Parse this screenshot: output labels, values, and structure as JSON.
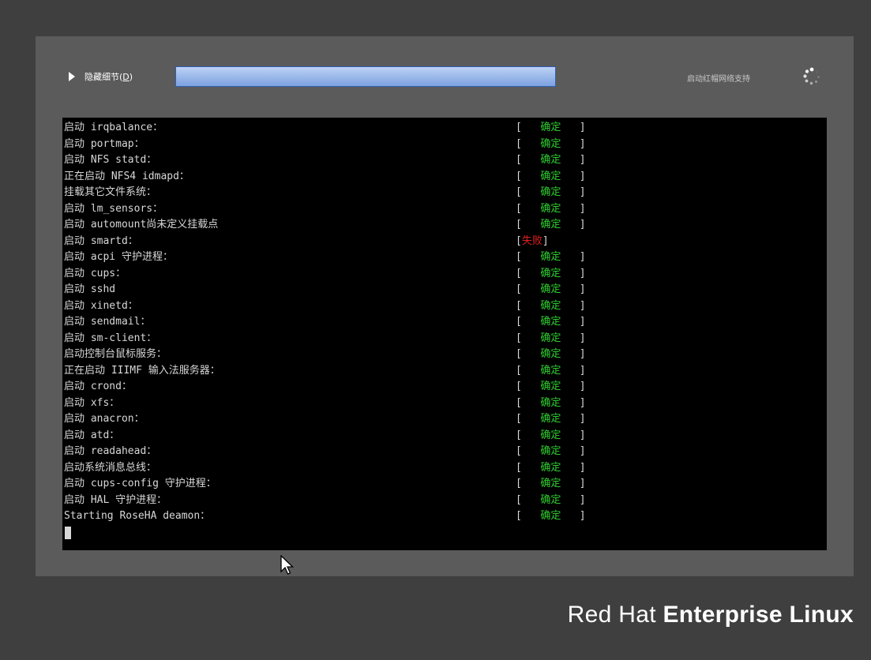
{
  "header": {
    "toggle_label_prefix": "隐藏细节(",
    "toggle_label_key": "D",
    "toggle_label_suffix": ")",
    "status_text": "启动红帽网络支持"
  },
  "console": {
    "lines": [
      {
        "msg": "启动 irqbalance：",
        "status": "确定"
      },
      {
        "msg": "启动 portmap：",
        "status": "确定"
      },
      {
        "msg": "启动 NFS statd：",
        "status": "确定"
      },
      {
        "msg": "正在启动 NFS4 idmapd：",
        "status": "确定"
      },
      {
        "msg": "挂载其它文件系统：",
        "status": "确定"
      },
      {
        "msg": "启动 lm_sensors：",
        "status": "确定"
      },
      {
        "msg": "启动 automount尚未定义挂载点",
        "status": "确定"
      },
      {
        "msg": "启动 smartd：",
        "status": "失败"
      },
      {
        "msg": "启动 acpi 守护进程：",
        "status": "确定"
      },
      {
        "msg": "启动 cups：",
        "status": "确定"
      },
      {
        "msg": "启动 sshd",
        "status": "确定"
      },
      {
        "msg": "启动 xinetd：",
        "status": "确定"
      },
      {
        "msg": "启动 sendmail：",
        "status": "确定"
      },
      {
        "msg": "启动 sm-client：",
        "status": "确定"
      },
      {
        "msg": "启动控制台鼠标服务：",
        "status": "确定"
      },
      {
        "msg": "正在启动 IIIMF 输入法服务器：",
        "status": "确定"
      },
      {
        "msg": "启动 crond：",
        "status": "确定"
      },
      {
        "msg": "启动 xfs：",
        "status": "确定"
      },
      {
        "msg": "启动 anacron：",
        "status": "确定"
      },
      {
        "msg": "启动 atd：",
        "status": "确定"
      },
      {
        "msg": "启动 readahead：",
        "status": "确定"
      },
      {
        "msg": "启动系统消息总线：",
        "status": "确定"
      },
      {
        "msg": "启动 cups-config 守护进程：",
        "status": "确定"
      },
      {
        "msg": "启动 HAL 守护进程：",
        "status": "确定"
      },
      {
        "msg": "Starting RoseHA deamon：",
        "status": "确定"
      }
    ],
    "ok_color": "#2fcf2f",
    "fail_color": "#e02020",
    "fail_status": "失败"
  },
  "brand": {
    "part1": "Red Hat ",
    "part2": "Enterprise Linux"
  },
  "icons": {
    "toggle": "triangle-right-icon",
    "spinner": "spinner-icon",
    "pointer": "mouse-pointer-icon"
  }
}
